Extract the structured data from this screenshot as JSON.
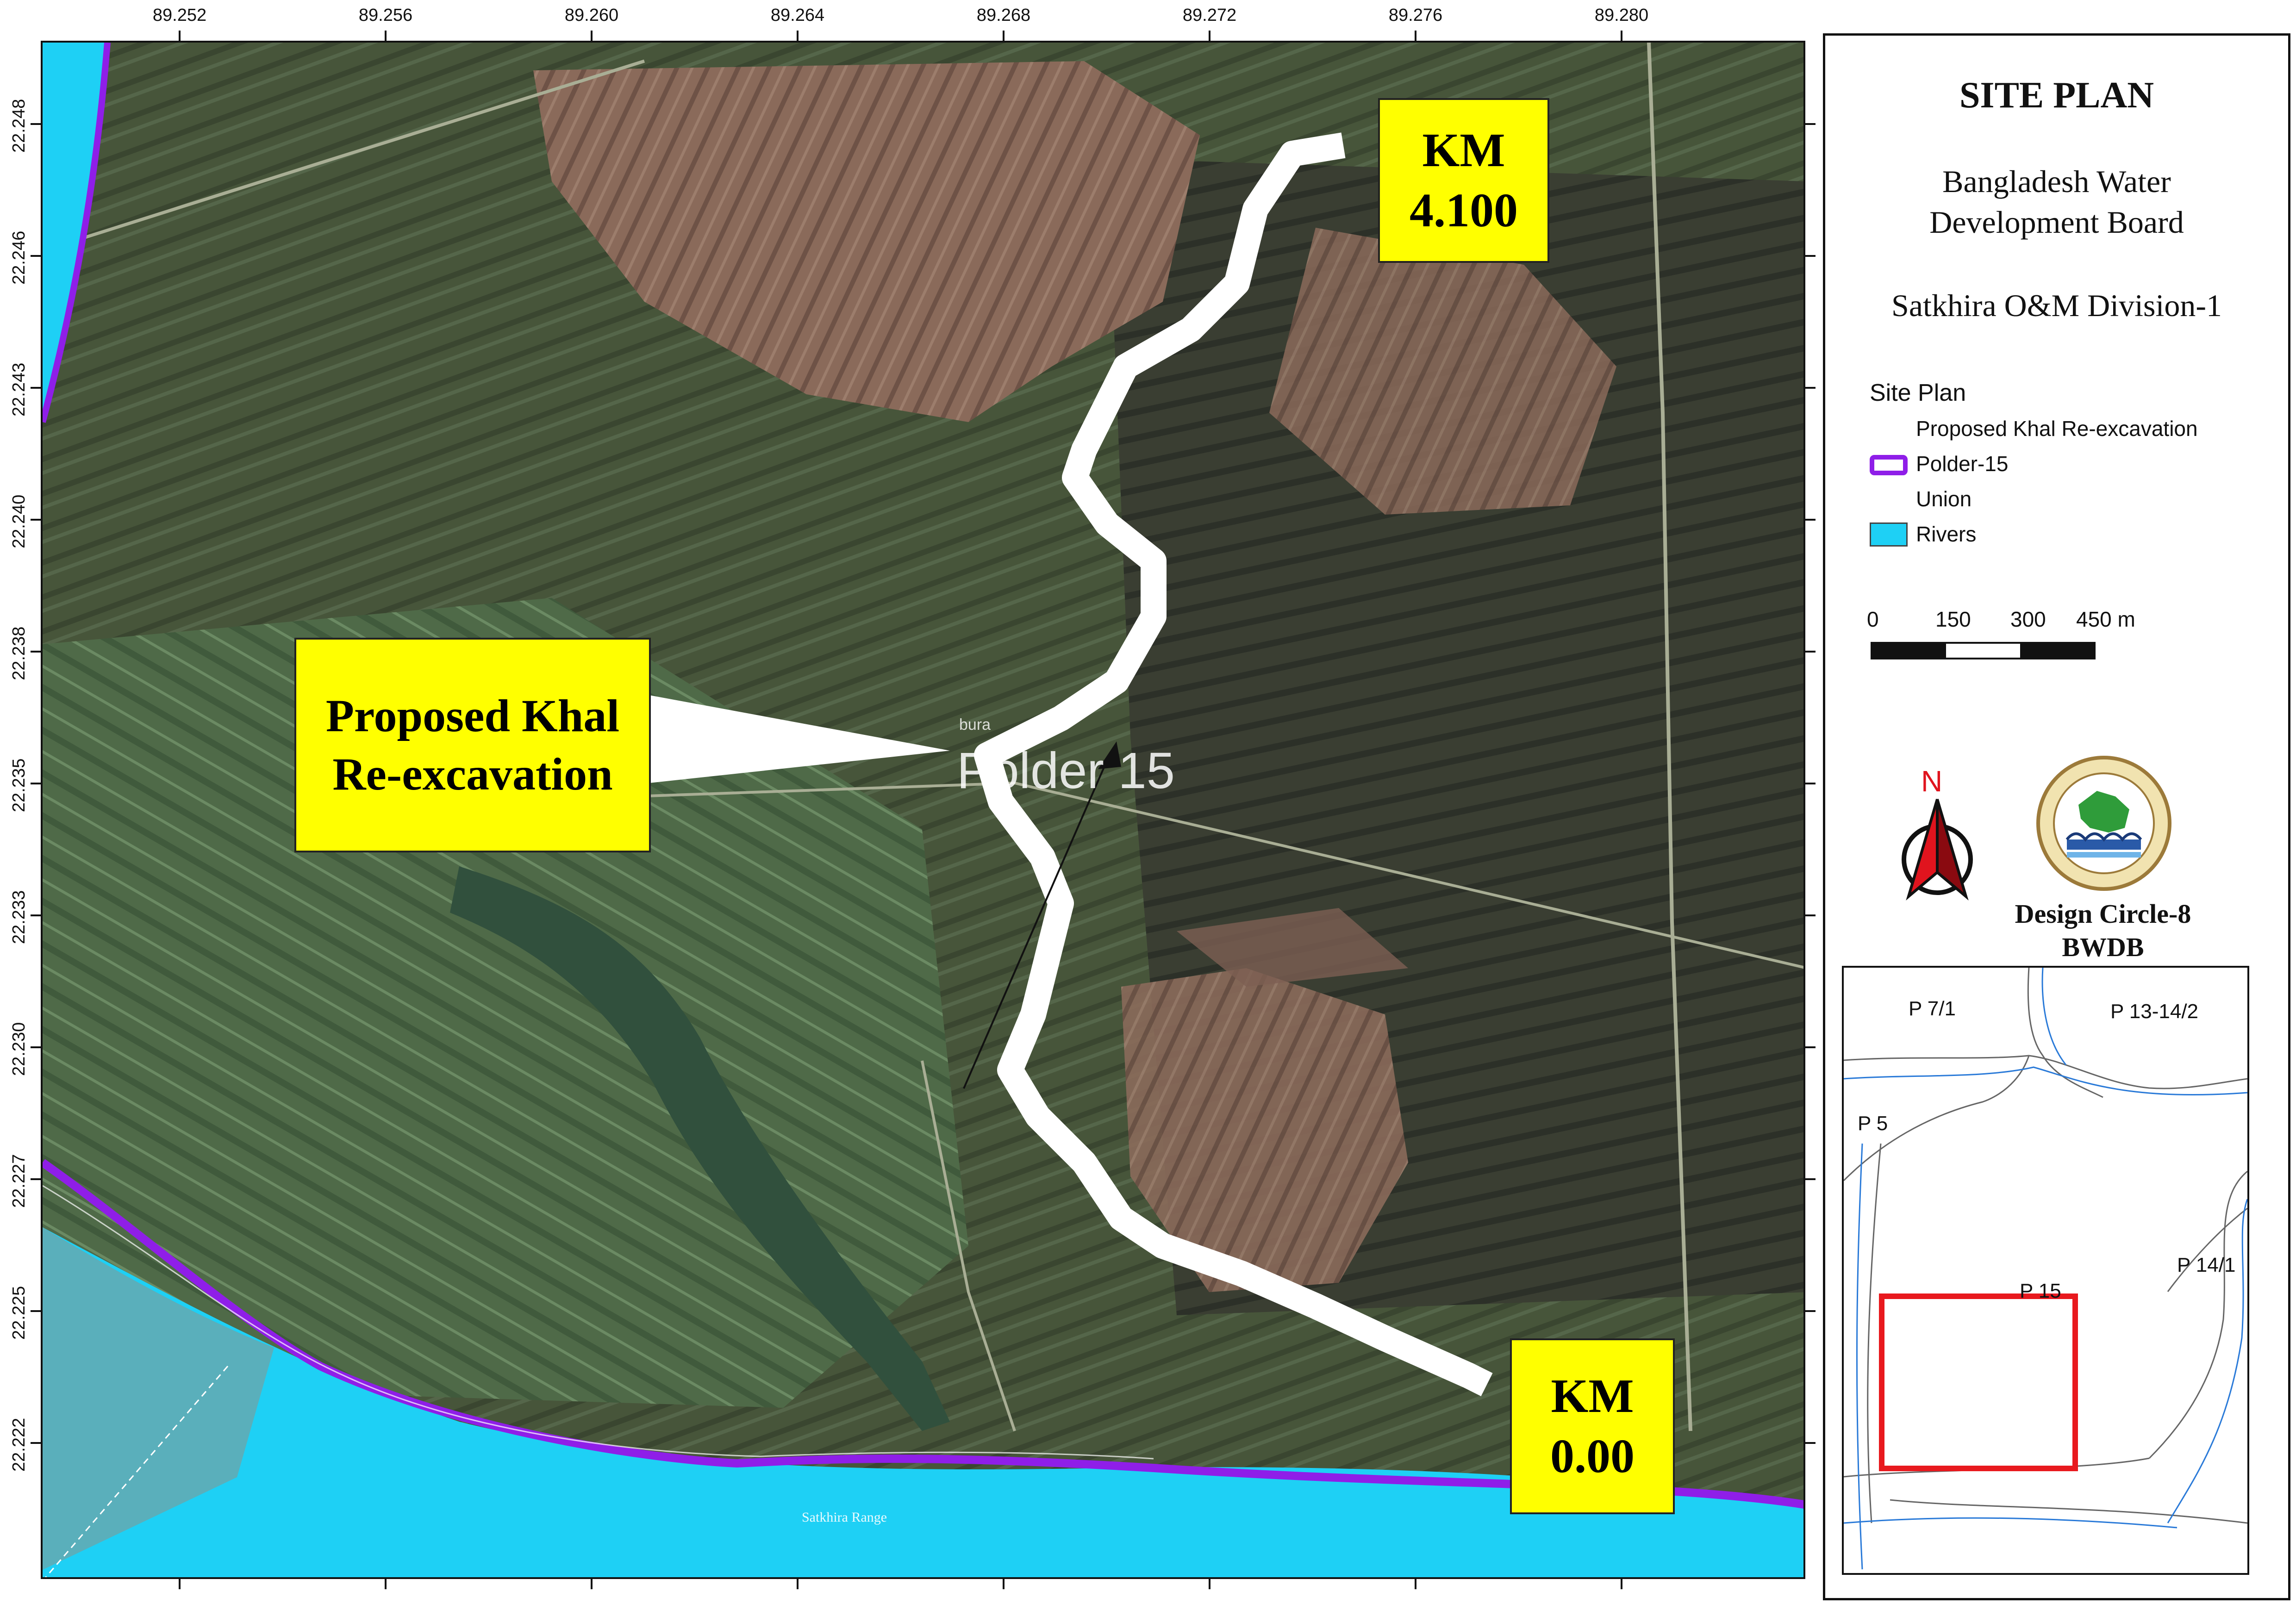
{
  "axes": {
    "longitude_ticks": [
      "89.252",
      "89.256",
      "89.260",
      "89.264",
      "89.268",
      "89.272",
      "89.276",
      "89.280"
    ],
    "latitude_ticks": [
      "22.248",
      "22.246",
      "22.243",
      "22.240",
      "22.238",
      "22.235",
      "22.233",
      "22.230",
      "22.227",
      "22.225",
      "22.222"
    ]
  },
  "map": {
    "callout_khal": "Proposed Khal\nRe-excavation",
    "callout_km_start": "KM\n0.00",
    "callout_km_end": "KM\n4.100",
    "polder_label": "Polder 15",
    "river_label": "Satkhira Range",
    "village_label": "bura",
    "colors": {
      "river": "#1ed0f5",
      "polder": "#8f1ee8",
      "khal": "#ffffff",
      "callout": "#ffff00",
      "inset_extent": "#e8191e"
    }
  },
  "legend": {
    "title": "SITE PLAN",
    "org_line1": "Bangladesh Water",
    "org_line2": "Development Board",
    "division": "Satkhira O&M Division-1",
    "section_title": "Site Plan",
    "items": [
      {
        "label": "Proposed Khal Re-excavation",
        "symbol": "none"
      },
      {
        "label": "Polder-15",
        "symbol": "purple-outline"
      },
      {
        "label": "Union",
        "symbol": "none"
      },
      {
        "label": "Rivers",
        "symbol": "cyan-fill"
      }
    ],
    "scale_labels": [
      "0",
      "150",
      "300",
      "450 m"
    ],
    "north_label": "N",
    "credit_line1": "Design Circle-8",
    "credit_line2": "BWDB"
  },
  "inset": {
    "labels": [
      "P 7/1",
      "P 13-14/2",
      "P 5",
      "P 14/1",
      "P 15"
    ]
  }
}
